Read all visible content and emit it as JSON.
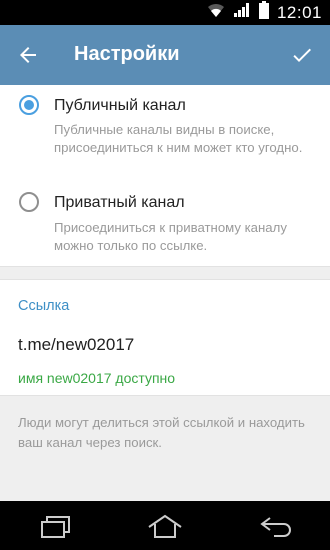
{
  "status_bar": {
    "time": "12:01",
    "icons": [
      "wifi-icon",
      "signal-icon",
      "battery-icon"
    ]
  },
  "app_bar": {
    "title": "Настройки",
    "back_icon": "arrow-back-icon",
    "done_icon": "check-icon",
    "background": "#5b8db5"
  },
  "options": [
    {
      "title": "Публичный канал",
      "description": "Публичные каналы видны в поиске, присоединиться к ним может кто угодно.",
      "selected": true
    },
    {
      "title": "Приватный канал",
      "description": "Присоединиться к приватному каналу можно только по ссылке.",
      "selected": false
    }
  ],
  "link_section": {
    "header": "Ссылка",
    "value": "t.me/new02017",
    "availability": "имя new02017 доступно"
  },
  "info": {
    "text": "Люди могут делиться этой ссылкой и находить ваш канал через поиск."
  },
  "nav_bar": {
    "icons": [
      "recent-apps-icon",
      "home-icon",
      "back-nav-icon"
    ]
  },
  "colors": {
    "accent": "#4a9fe0",
    "link_header": "#3d8fc6",
    "available": "#3aa845"
  }
}
